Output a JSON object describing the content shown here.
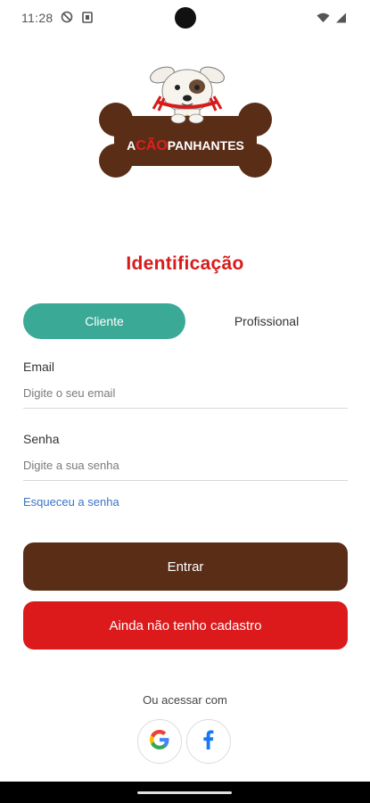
{
  "status": {
    "time": "11:28",
    "left_icons": [
      "dnd-icon",
      "storage-icon"
    ],
    "right_icons": [
      "wifi-icon",
      "signal-icon"
    ]
  },
  "logo": {
    "text_prefix": "A",
    "text_highlight": "CÃO",
    "text_suffix": "PANHANTES",
    "colors": {
      "bone": "#5a2d17",
      "highlight": "#e0201e",
      "collar": "#d71b1b"
    }
  },
  "page": {
    "title": "Identificação"
  },
  "tabs": [
    {
      "label": "Cliente",
      "active": true
    },
    {
      "label": "Profissional",
      "active": false
    }
  ],
  "form": {
    "email": {
      "label": "Email",
      "placeholder": "Digite o seu email",
      "value": ""
    },
    "password": {
      "label": "Senha",
      "placeholder": "Digite a sua senha",
      "value": ""
    },
    "forgot_label": "Esqueceu a senha"
  },
  "buttons": {
    "enter": "Entrar",
    "register": "Ainda não tenho cadastro"
  },
  "alt_login": {
    "label": "Ou acessar com",
    "providers": [
      "google-icon",
      "facebook-icon"
    ]
  },
  "colors": {
    "accent_teal": "#3aa996",
    "brown": "#5a2d17",
    "red": "#dc1a1c",
    "link_blue": "#3b73c9",
    "title_red": "#d71b1b"
  }
}
